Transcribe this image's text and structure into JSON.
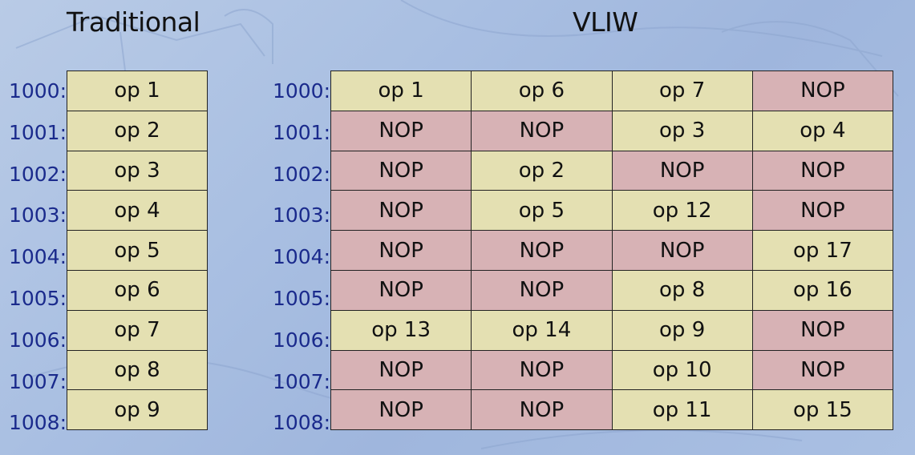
{
  "titles": {
    "traditional": "Traditional",
    "vliw": "VLIW"
  },
  "addresses": [
    "1000:",
    "1001:",
    "1002:",
    "1003:",
    "1004:",
    "1005:",
    "1006:",
    "1007:",
    "1008:"
  ],
  "traditional_ops": [
    "op 1",
    "op 2",
    "op 3",
    "op 4",
    "op 5",
    "op 6",
    "op 7",
    "op 8",
    "op 9"
  ],
  "vliw_rows": [
    [
      "op 1",
      "op 6",
      "op 7",
      "NOP"
    ],
    [
      "NOP",
      "NOP",
      "op 3",
      "op 4"
    ],
    [
      "NOP",
      "op 2",
      "NOP",
      "NOP"
    ],
    [
      "NOP",
      "op 5",
      "op 12",
      "NOP"
    ],
    [
      "NOP",
      "NOP",
      "NOP",
      "op 17"
    ],
    [
      "NOP",
      "NOP",
      "op 8",
      "op 16"
    ],
    [
      "op 13",
      "op 14",
      "op 9",
      "NOP"
    ],
    [
      "NOP",
      "NOP",
      "op 10",
      "NOP"
    ],
    [
      "NOP",
      "NOP",
      "op 11",
      "op 15"
    ]
  ],
  "colors": {
    "op_cell": "#e4e0b2",
    "nop_cell": "#d7b2b5",
    "address_text": "#1a2a8c"
  }
}
